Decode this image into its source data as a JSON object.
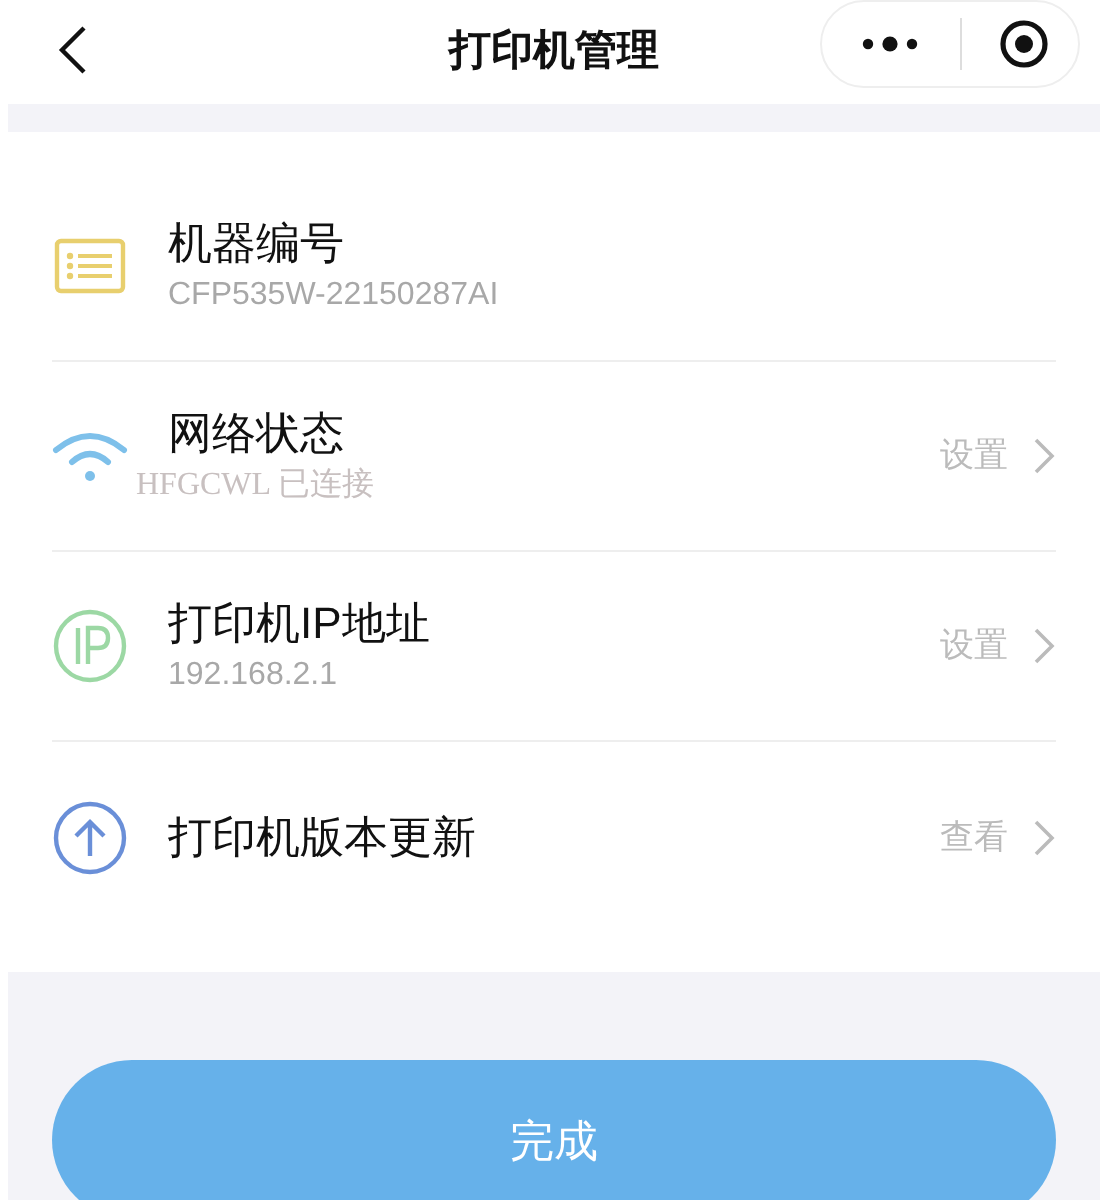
{
  "header": {
    "title": "打印机管理"
  },
  "items": [
    {
      "title": "机器编号",
      "subtitle": "CFP535W-22150287AI"
    },
    {
      "title": "网络状态",
      "subtitle": "HFGCWL 已连接",
      "action": "设置"
    },
    {
      "title": "打印机IP地址",
      "subtitle": "192.168.2.1",
      "action": "设置"
    },
    {
      "title": "打印机版本更新",
      "action": "查看"
    }
  ],
  "button": {
    "label": "完成"
  }
}
